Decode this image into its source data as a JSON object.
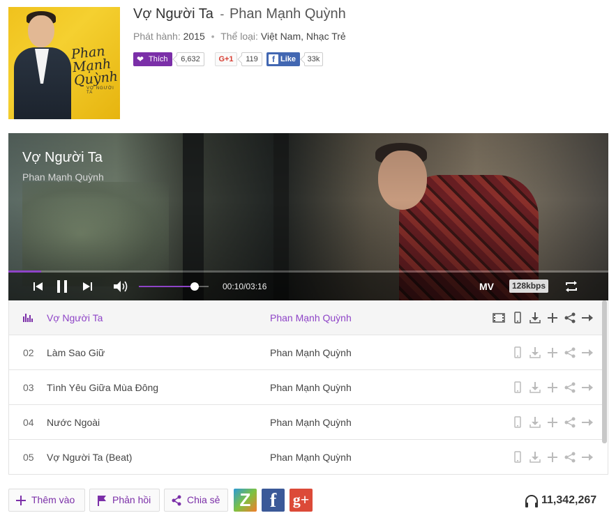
{
  "album": {
    "title": "Vợ Người Ta",
    "separator": "-",
    "artist": "Phan Mạnh Quỳnh",
    "release_label": "Phát hành:",
    "release_year": "2015",
    "genre_label": "Thể loại:",
    "genres": "Việt Nam, Nhạc Trẻ",
    "cover_text_line1": "Phan",
    "cover_text_line2": "Mạnh",
    "cover_text_line3": "Quỳnh",
    "cover_subtitle": "VỢ NGƯỜI TA"
  },
  "social": {
    "like_label": "Thích",
    "like_count": "6,632",
    "gplus_label": "G+1",
    "gplus_count": "119",
    "fb_label": "Like",
    "fb_count": "33k"
  },
  "player": {
    "song_title": "Vợ Người Ta",
    "song_artist": "Phan Mạnh Quỳnh",
    "time": "00:10/03:16",
    "progress_fraction": 0.055,
    "volume_fraction": 0.8,
    "mv_label": "MV",
    "bitrate": "128kbps",
    "accent_color": "#8e44c7"
  },
  "playlist": [
    {
      "num": "",
      "title": "Vợ Người Ta",
      "artist": "Phan Mạnh Quỳnh",
      "active": true
    },
    {
      "num": "02",
      "title": "Làm Sao Giữ",
      "artist": "Phan Mạnh Quỳnh",
      "active": false
    },
    {
      "num": "03",
      "title": "Tình Yêu Giữa Mùa Đông",
      "artist": "Phan Mạnh Quỳnh",
      "active": false
    },
    {
      "num": "04",
      "title": "Nước Ngoài",
      "artist": "Phan Mạnh Quỳnh",
      "active": false
    },
    {
      "num": "05",
      "title": "Vợ Người Ta (Beat)",
      "artist": "Phan Mạnh Quỳnh",
      "active": false
    }
  ],
  "footer": {
    "add_label": "Thêm vào",
    "report_label": "Phản hồi",
    "share_label": "Chia sẻ",
    "zing_glyph": "Z",
    "fb_glyph": "f",
    "gplus_glyph": "g+",
    "listen_count": "11,342,267"
  }
}
